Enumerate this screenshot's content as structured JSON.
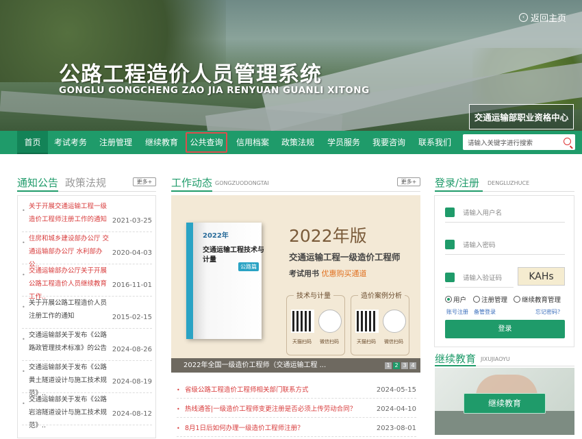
{
  "header": {
    "title_cn": "公路工程造价人员管理系统",
    "title_py": "GONGLU GONGCHENG ZAO JIA RENYUAN GUANLI XITONG",
    "back_home": "返回主页",
    "badge": "交通运输部职业资格中心"
  },
  "nav": {
    "items": [
      "首页",
      "考试考务",
      "注册管理",
      "继续教育",
      "公共查询",
      "信用档案",
      "政策法规",
      "学员服务",
      "我要咨询",
      "联系我们"
    ],
    "active": "首页",
    "highlighted": "公共查询",
    "search_placeholder": "请输入关键字进行搜索"
  },
  "notice": {
    "tab_active": "通知公告",
    "tab_other": "政策法规",
    "more": "更多+",
    "items": [
      {
        "title": "关于开展交通运输工程一级造价工程师注册工作的通知",
        "date": "2021-03-25",
        "style": "red"
      },
      {
        "title": "住房和城乡建设部办公厅 交通运输部办公厅 水利部办公..",
        "date": "2020-04-03",
        "style": "red"
      },
      {
        "title": "交通运输部办公厅关于开展公路工程造价人员继续教育工作..",
        "date": "2016-11-01",
        "style": "red"
      },
      {
        "title": "关于开展公路工程造价人员注册工作的通知",
        "date": "2015-02-15",
        "style": "dark"
      },
      {
        "title": "交通运输部关于发布《公路路政管理技术标准》的公告",
        "date": "2024-08-26",
        "style": "dark"
      },
      {
        "title": "交通运输部关于发布《公路黄土隧道设计与施工技术规范》..",
        "date": "2024-08-19",
        "style": "dark"
      },
      {
        "title": "交通运输部关于发布《公路岩溶隧道设计与施工技术规范》..",
        "date": "2024-08-12",
        "style": "dark"
      }
    ]
  },
  "work": {
    "title": "工作动态",
    "subtitle": "GONGZUODONGTAI",
    "more": "更多+",
    "slide": {
      "book_year": "2022年",
      "book_title": "交通运输工程技术与计量",
      "book_tag": "公路篇",
      "big_year": "2022年版",
      "big_title": "交通运输工程一级造价工程师",
      "big_sub_prefix": "考试用书",
      "big_sub_link": "优惠购买通道",
      "box1_label": "技术与计量",
      "box2_label": "造价案例分析",
      "qr_tmall": "天猫扫码",
      "qr_wechat": "微信扫码",
      "caption": "2022年全国一级造价工程师（交通运输工程 ..."
    },
    "pager": [
      "1",
      "2",
      "3",
      "4"
    ],
    "pager_active": "2",
    "news": [
      {
        "title": "省级公路工程造价工程师相关部门联系方式",
        "date": "2024-05-15"
      },
      {
        "title": "热线通答|一级造价工程师变更注册是否必须上传劳动合同？",
        "date": "2024-04-10"
      },
      {
        "title": "8月1日后如何办理一级造价工程师注册？",
        "date": "2023-08-01"
      }
    ]
  },
  "login": {
    "title": "登录/注册",
    "subtitle": "DENGLUZHUCE",
    "username_placeholder": "请输入用户名",
    "password_placeholder": "请输入密码",
    "captcha_placeholder": "请输入验证码",
    "captcha_text": "KAHs",
    "roles": [
      "用户",
      "注册管理",
      "继续教育管理"
    ],
    "role_selected": "用户",
    "link_register": "账号注册",
    "link_backup": "备管登录",
    "link_forgot": "忘记密码？",
    "button": "登录"
  },
  "continuing": {
    "title": "继续教育",
    "subtitle": "JIXUJIAOYU",
    "button": "继续教育"
  },
  "colors": {
    "primary": "#1f9b6a",
    "red": "#d83b3b",
    "highlight_border": "#e04c4c"
  }
}
